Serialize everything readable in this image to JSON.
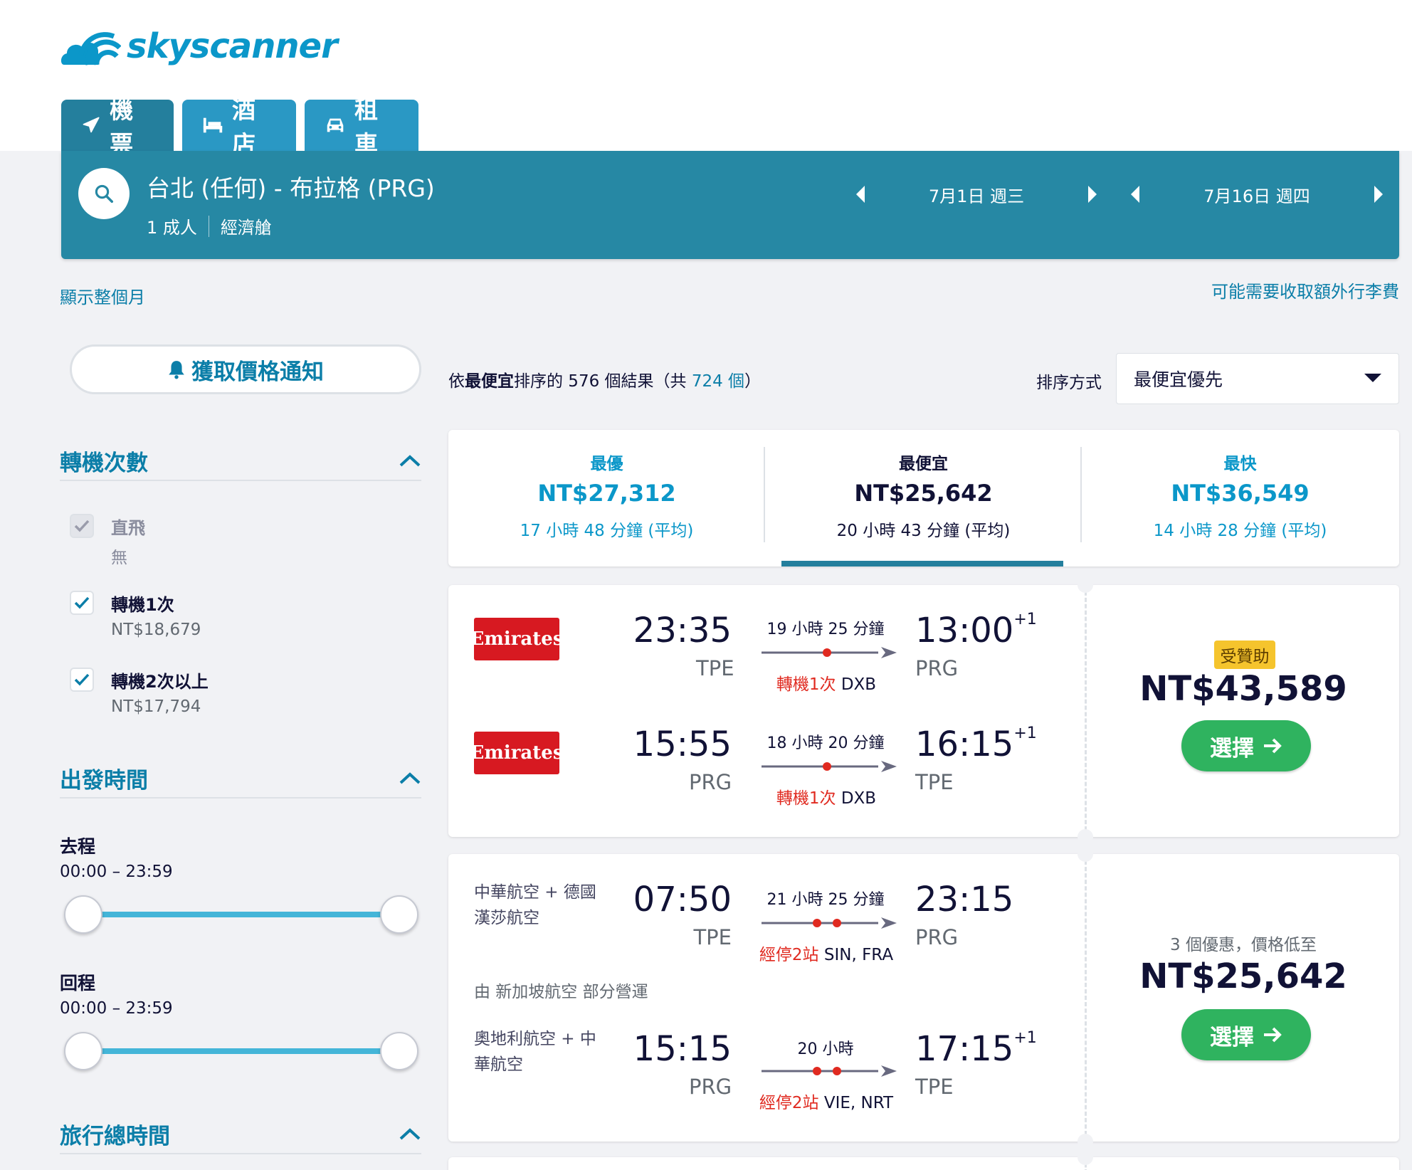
{
  "brand": {
    "name": "skyscanner",
    "color": "#0b97c9"
  },
  "tabs": [
    {
      "label": "機票",
      "icon": "plane-icon",
      "active": true
    },
    {
      "label": "酒店",
      "icon": "bed-icon",
      "active": false
    },
    {
      "label": "租車",
      "icon": "car-icon",
      "active": false
    }
  ],
  "search": {
    "route": "台北 (任何) - 布拉格 (PRG)",
    "passengers": "1 成人",
    "cabin": "經濟艙",
    "depart_date": "7月1日 週三",
    "return_date": "7月16日 週四"
  },
  "links": {
    "show_month": "顯示整個月",
    "baggage_fee": "可能需要收取額外行李費"
  },
  "price_alert": {
    "label": "獲取價格通知"
  },
  "filters": {
    "stops": {
      "title": "轉機次數",
      "options": [
        {
          "label": "直飛",
          "sub": "無",
          "checked": true,
          "disabled": true
        },
        {
          "label": "轉機1次",
          "sub": "NT$18,679",
          "checked": true,
          "disabled": false
        },
        {
          "label": "轉機2次以上",
          "sub": "NT$17,794",
          "checked": true,
          "disabled": false
        }
      ]
    },
    "depart_time": {
      "title": "出發時間",
      "outbound_label": "去程",
      "outbound_range": "00:00 – 23:59",
      "return_label": "回程",
      "return_range": "00:00 – 23:59"
    },
    "duration": {
      "title": "旅行總時間"
    }
  },
  "results": {
    "prefix": "依",
    "sort_word": "最便宜",
    "middle": "排序的 576 個結果（共 ",
    "total": "724 個",
    "suffix": "）",
    "sort_label": "排序方式",
    "sort_value": "最便宜優先"
  },
  "summary": [
    {
      "title": "最優",
      "price": "NT$27,312",
      "duration": "17 小時 48 分鐘 (平均)"
    },
    {
      "title": "最便宜",
      "price": "NT$25,642",
      "duration": "20 小時 43 分鐘 (平均)"
    },
    {
      "title": "最快",
      "price": "NT$36,549",
      "duration": "14 小時 28 分鐘 (平均)"
    }
  ],
  "cards": [
    {
      "badge": "受贊助",
      "price": "NT$43,589",
      "select_label": "選擇",
      "legs": [
        {
          "airline": "Emirates",
          "dep_time": "23:35",
          "dep_code": "TPE",
          "duration": "19 小時 25 分鐘",
          "stops_red": "轉機1次",
          "stops_via": " DXB",
          "arr_time": "13:00",
          "arr_plus": "+1",
          "arr_code": "PRG"
        },
        {
          "airline": "Emirates",
          "dep_time": "15:55",
          "dep_code": "PRG",
          "duration": "18 小時 20 分鐘",
          "stops_red": "轉機1次",
          "stops_via": " DXB",
          "arr_time": "16:15",
          "arr_plus": "+1",
          "arr_code": "TPE"
        }
      ]
    },
    {
      "deals": "3 個優惠，價格低至",
      "price": "NT$25,642",
      "select_label": "選擇",
      "operated": "由 新加坡航空 部分營運",
      "legs": [
        {
          "airline_l1": "中華航空 + 德國",
          "airline_l2": "漢莎航空",
          "dep_time": "07:50",
          "dep_code": "TPE",
          "duration": "21 小時 25 分鐘",
          "stops_red": "經停2站",
          "stops_via": " SIN, FRA",
          "arr_time": "23:15",
          "arr_plus": "",
          "arr_code": "PRG"
        },
        {
          "airline_l1": "奧地利航空 + 中",
          "airline_l2": "華航空",
          "dep_time": "15:15",
          "dep_code": "PRG",
          "duration": "20 小時",
          "stops_red": "經停2站",
          "stops_via": " VIE, NRT",
          "arr_time": "17:15",
          "arr_plus": "+1",
          "arr_code": "TPE"
        }
      ]
    }
  ]
}
